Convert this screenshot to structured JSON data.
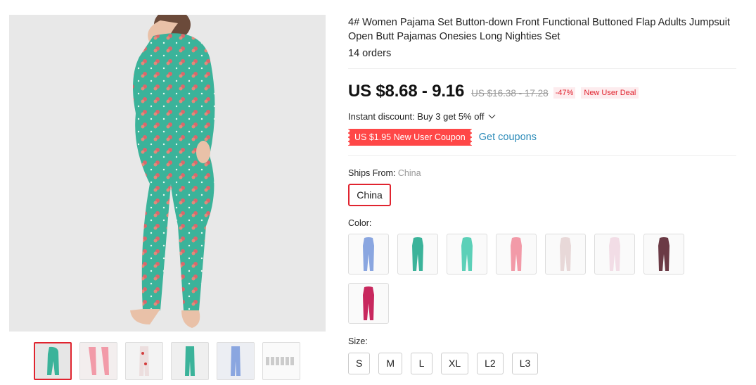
{
  "product": {
    "title": "4# Women Pajama Set Button-down Front Functional Buttoned Flap Adults Jumpsuit Open Butt Pajamas Onesies Long Nighties Set",
    "orders": "14 orders"
  },
  "price": {
    "current": "US $8.68 - 9.16",
    "original": "US $16.38 - 17.28",
    "discount_badge": "-47%",
    "deal_badge": "New User Deal",
    "instant_discount": "Instant discount: Buy 3 get 5% off",
    "coupon_label": "US $1.95 New User Coupon",
    "get_coupons": "Get coupons"
  },
  "shipping": {
    "label": "Ships From:",
    "value": "China",
    "option": "China"
  },
  "color": {
    "label": "Color:",
    "swatches": [
      {
        "icon": "jumpsuit-blue-icon",
        "color": "#8aa6e0"
      },
      {
        "icon": "jumpsuit-teal-icon",
        "color": "#3bb39a"
      },
      {
        "icon": "jumpsuit-mint-icon",
        "color": "#5cd0b8"
      },
      {
        "icon": "jumpsuit-pink-icon",
        "color": "#f29aa8"
      },
      {
        "icon": "jumpsuit-white-red-icon",
        "color": "#e8d8d8"
      },
      {
        "icon": "jumpsuit-white-pink-icon",
        "color": "#f2dde6"
      },
      {
        "icon": "jumpsuit-dark-floral-icon",
        "color": "#6b3a45"
      },
      {
        "icon": "jumpsuit-magenta-icon",
        "color": "#c8285e"
      }
    ]
  },
  "size": {
    "label": "Size:",
    "options": [
      "S",
      "M",
      "L",
      "XL",
      "L2",
      "L3"
    ]
  },
  "gallery": {
    "thumbnails": [
      {
        "icon": "thumb-teal-back-icon",
        "color": "#3bb39a"
      },
      {
        "icon": "thumb-pink-icon",
        "color": "#f29aa8"
      },
      {
        "icon": "thumb-white-cherry-icon",
        "color": "#e8d8d8"
      },
      {
        "icon": "thumb-teal-front-icon",
        "color": "#3bb39a"
      },
      {
        "icon": "thumb-blue-icon",
        "color": "#8aa6e0"
      },
      {
        "icon": "thumb-size-chart-icon",
        "color": "#cccccc"
      }
    ]
  },
  "colors": {
    "accent_red": "#e0242f",
    "coupon_red": "#ff4747",
    "link_blue": "#2a8ab8",
    "jumpsuit_teal": "#3bb39a"
  }
}
